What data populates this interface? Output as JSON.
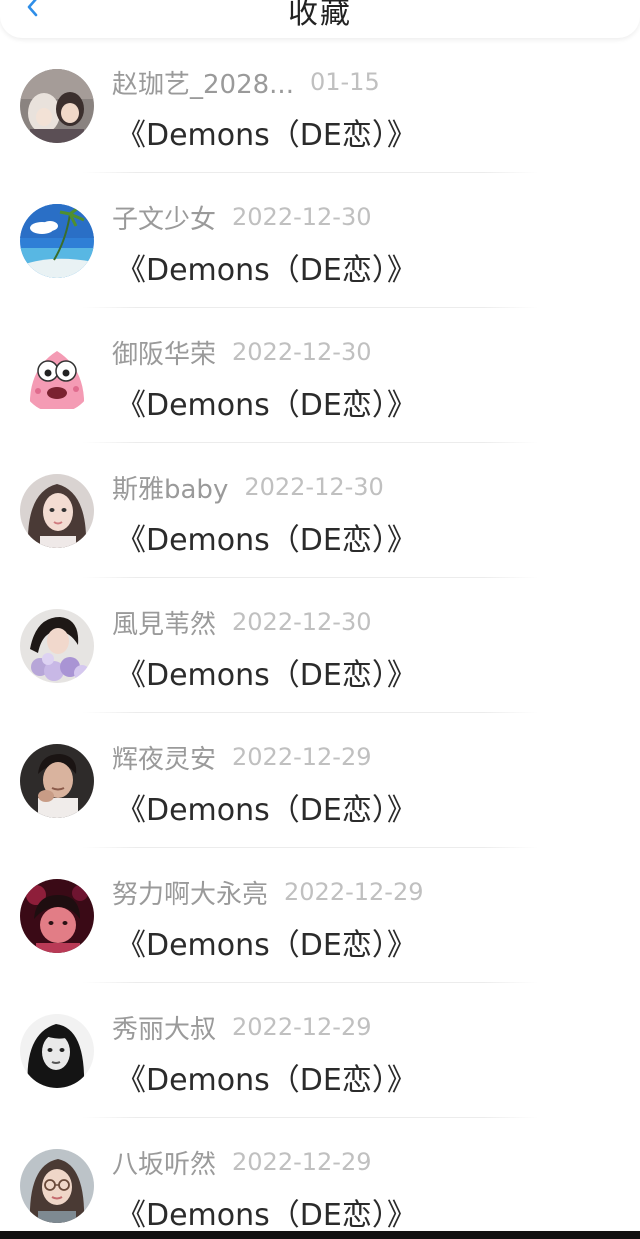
{
  "header": {
    "title": "收藏",
    "back_icon": "chevron-left-icon",
    "accent_color": "#2f8ee8"
  },
  "items": [
    {
      "username": "赵珈艺_2028...",
      "date": "01-15",
      "title": "《Demons（DE恋）》",
      "avatar": "anime-characters"
    },
    {
      "username": "子文少女",
      "date": "2022-12-30",
      "title": "《Demons（DE恋）》",
      "avatar": "beach-palm-tree"
    },
    {
      "username": "御阪华荣",
      "date": "2022-12-30",
      "title": "《Demons（DE恋）》",
      "avatar": "pink-cartoon-starfish"
    },
    {
      "username": "斯雅baby",
      "date": "2022-12-30",
      "title": "《Demons（DE恋）》",
      "avatar": "woman-portrait"
    },
    {
      "username": "風見苇然",
      "date": "2022-12-30",
      "title": "《Demons（DE恋）》",
      "avatar": "woman-with-flowers"
    },
    {
      "username": "辉夜灵安",
      "date": "2022-12-29",
      "title": "《Demons（DE恋）》",
      "avatar": "man-portrait"
    },
    {
      "username": "努力啊大永亮",
      "date": "2022-12-29",
      "title": "《Demons（DE恋）》",
      "avatar": "child-red-light"
    },
    {
      "username": "秀丽大叔",
      "date": "2022-12-29",
      "title": "《Demons（DE恋）》",
      "avatar": "woman-black-white"
    },
    {
      "username": "八坂听然",
      "date": "2022-12-29",
      "title": "《Demons（DE恋）》",
      "avatar": "girl-with-glasses"
    }
  ]
}
